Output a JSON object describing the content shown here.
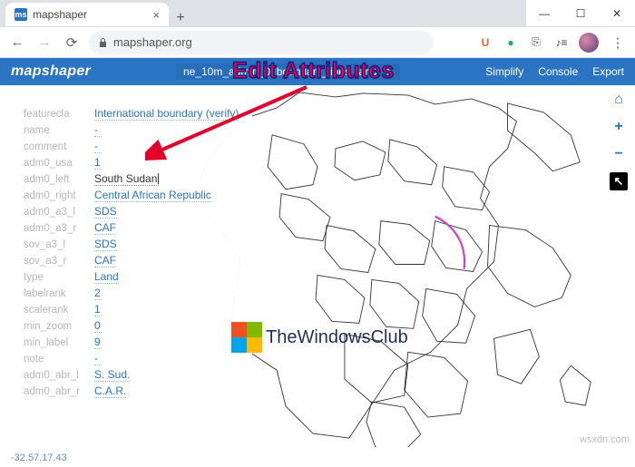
{
  "browser": {
    "tab_title": "mapshaper",
    "tab_favicon_text": "ms",
    "url_host": "mapshaper.org",
    "nav": {
      "back": "←",
      "forward": "→",
      "reload": "⟳"
    },
    "lock_icon": "lock-icon",
    "ext": {
      "u": "U",
      "greendot": "●",
      "note": "⎘",
      "music": "♪≡"
    },
    "win": {
      "min": "—",
      "max": "☐",
      "close": "✕"
    },
    "new_tab": "+",
    "menu": "⋮"
  },
  "app": {
    "name": "mapshaper",
    "layer": "ne_10m_admin_0_boundary_lines_land",
    "dropdown_glyph": "▼",
    "links": {
      "simplify": "Simplify",
      "console": "Console",
      "export": "Export"
    }
  },
  "annotation": {
    "title": "Edit Attributes"
  },
  "attributes": [
    {
      "key": "featurecla",
      "value": "International boundary (verify)"
    },
    {
      "key": "name",
      "value": "-"
    },
    {
      "key": "comment",
      "value": "-"
    },
    {
      "key": "adm0_usa",
      "value": "1"
    },
    {
      "key": "adm0_left",
      "value": "South Sudan",
      "editing": true
    },
    {
      "key": "adm0_right",
      "value": "Central African Republic"
    },
    {
      "key": "adm0_a3_l",
      "value": "SDS"
    },
    {
      "key": "adm0_a3_r",
      "value": "CAF"
    },
    {
      "key": "sov_a3_l",
      "value": "SDS"
    },
    {
      "key": "sov_a3_r",
      "value": "CAF"
    },
    {
      "key": "type",
      "value": "Land"
    },
    {
      "key": "labelrank",
      "value": "2"
    },
    {
      "key": "scalerank",
      "value": "1"
    },
    {
      "key": "min_zoom",
      "value": "0"
    },
    {
      "key": "min_label",
      "value": "9"
    },
    {
      "key": "note",
      "value": "-"
    },
    {
      "key": "adm0_abr_l",
      "value": "S. Sud."
    },
    {
      "key": "adm0_abr_r",
      "value": "C.A.R."
    }
  ],
  "tools": {
    "home": "⌂",
    "plus": "+",
    "minus": "−",
    "pointer": "↖"
  },
  "watermark": {
    "text": "TheWindowsClub"
  },
  "status": {
    "coords": "-32.57,17.43"
  },
  "attribution": "wsxdn.com"
}
